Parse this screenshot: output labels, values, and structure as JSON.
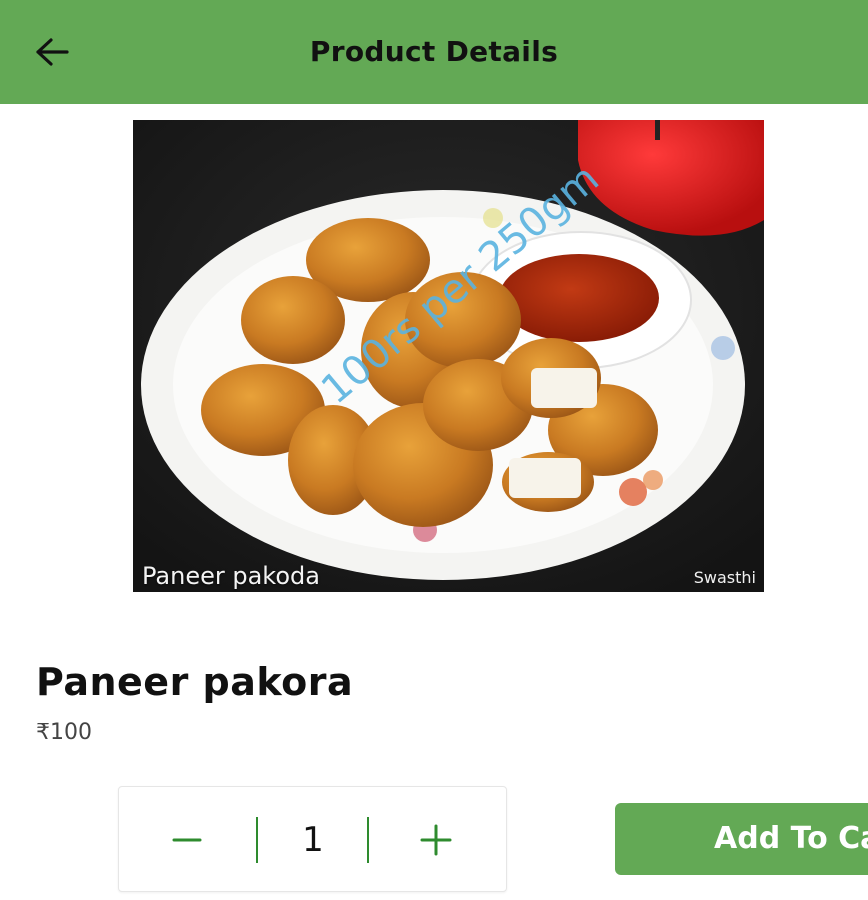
{
  "appbar": {
    "title": "Product Details",
    "back_icon": "arrow-left-icon",
    "color": "#63a955"
  },
  "product": {
    "name": "Paneer pakora",
    "price": "₹100",
    "image": {
      "caption": "Paneer pakoda",
      "credit": "Swasthi",
      "watermark": "100rs per 250gm"
    }
  },
  "quantity": {
    "minus_label": "−",
    "value": "1",
    "plus_label": "+",
    "accent": "#2e8b2e"
  },
  "actions": {
    "add_to_cart_label": "Add To Cart"
  }
}
